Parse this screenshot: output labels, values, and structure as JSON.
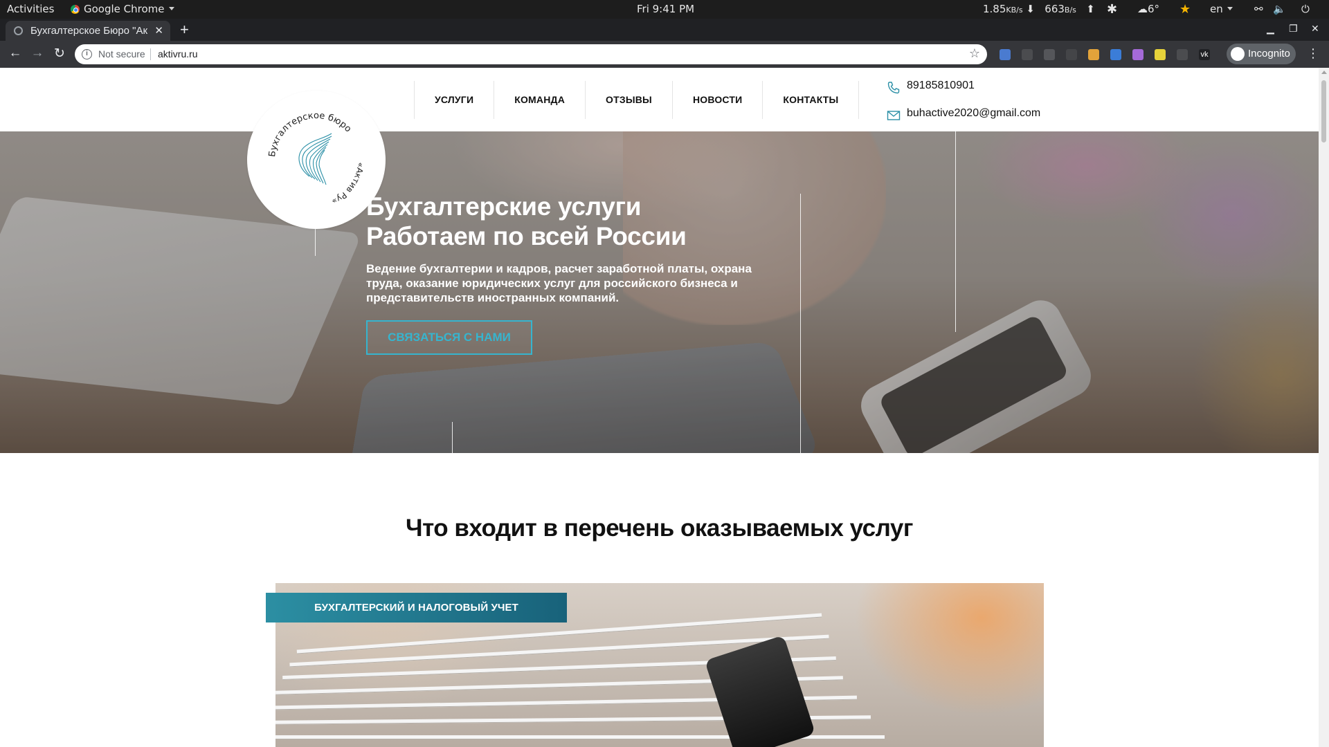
{
  "desktop": {
    "activities": "Activities",
    "app_name": "Google Chrome",
    "clock": "Fri  9:41 PM",
    "net_down_value": "1.85",
    "net_down_unit": "KB/s",
    "net_up_value": "663",
    "net_up_unit": "B/s",
    "weather": "6°",
    "lang": "en"
  },
  "browser": {
    "tab_title": "Бухгалтерское Бюро \"Ак",
    "security_label": "Not secure",
    "url": "aktivru.ru",
    "profile_label": "Incognito"
  },
  "site": {
    "nav": [
      "УСЛУГИ",
      "КОМАНДА",
      "ОТЗЫВЫ",
      "НОВОСТИ",
      "КОНТАКТЫ"
    ],
    "phone": "89185810901",
    "email": "buhactive2020@gmail.com",
    "logo_text_top": "Бухгалтерское бюро",
    "logo_text_side": "«Актив Ру»",
    "hero": {
      "title_line1": "Бухгалтерские услуги",
      "title_line2": "Работаем по всей России",
      "description": "Ведение бухгалтерии и кадров, расчет заработной платы, охрана труда, оказание юридических услуг для российского бизнеса и представительств иностранных компаний.",
      "cta": "СВЯЗАТЬСЯ С НАМИ"
    },
    "services_heading": "Что входит в перечень оказываемых услуг",
    "service_card_label": "БУХГАЛТЕРСКИЙ И НАЛОГОВЫЙ УЧЕТ"
  },
  "colors": {
    "accent": "#36b5cf",
    "badge_start": "#2c8fa3",
    "badge_end": "#18627a",
    "logo_wave": "#2a8fa6"
  }
}
